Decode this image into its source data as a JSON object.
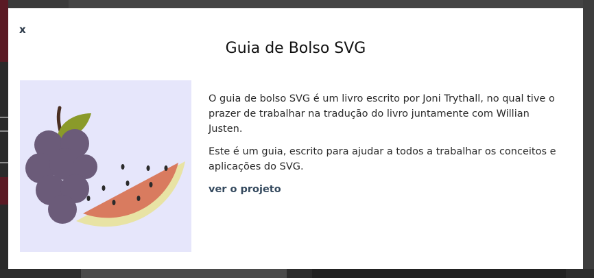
{
  "modal": {
    "close_label": "x",
    "title": "Guia de Bolso SVG",
    "paragraphs": [
      "O guia de bolso SVG é um livro escrito por Joni Trythall, no qual tive o prazer de trabalhar na tradução do livro juntamente com Willian Justen.",
      "Este é um guia, escrito para ajudar a todos a trabalhar os conceitos e aplicações do SVG."
    ],
    "link_label": "ver o projeto"
  },
  "colors": {
    "illustration_bg": "#e6e6fb",
    "grape": "#6b5b79",
    "leaf": "#8a9a2a",
    "melon_flesh": "#d97b5f",
    "melon_rind": "#e8e3a4",
    "link": "#34495e"
  }
}
